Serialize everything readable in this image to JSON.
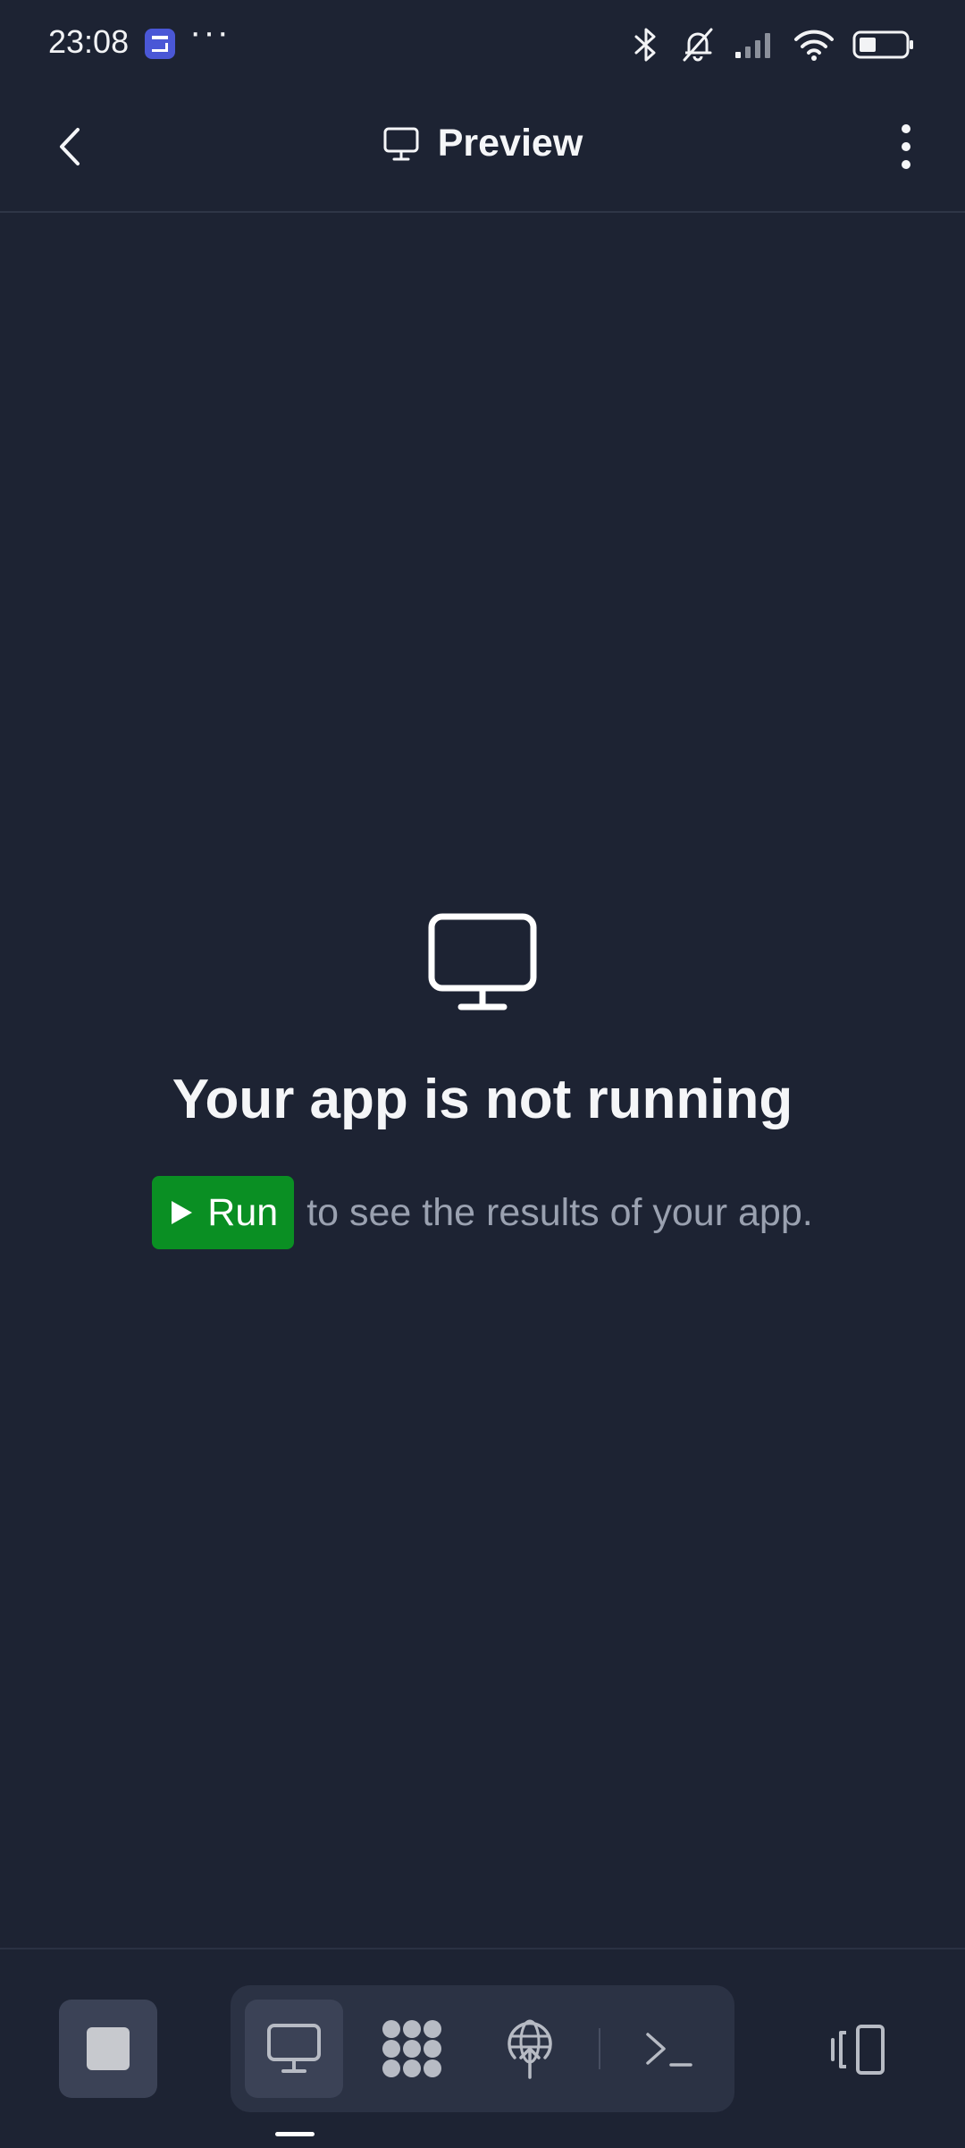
{
  "status_bar": {
    "time": "23:08",
    "overflow": "···",
    "icons": [
      "bluetooth-icon",
      "bell-off-icon",
      "signal-icon",
      "wifi-icon",
      "battery-icon"
    ]
  },
  "header": {
    "title": "Preview",
    "title_icon": "monitor-icon",
    "back_icon": "chevron-left-icon",
    "menu_icon": "more-vertical-icon"
  },
  "empty_state": {
    "icon": "monitor-icon",
    "title": "Your app is not running",
    "run_button": {
      "label": "Run",
      "icon": "play-icon"
    },
    "hint": "to see the results of your app."
  },
  "bottom_bar": {
    "stop_icon": "stop-icon",
    "tabs": [
      {
        "name": "preview",
        "icon": "monitor-icon",
        "active": true
      },
      {
        "name": "packages",
        "icon": "packages-icon",
        "active": false
      },
      {
        "name": "deploy",
        "icon": "globe-deploy-icon",
        "active": false
      },
      {
        "name": "console",
        "icon": "terminal-icon",
        "active": false
      }
    ],
    "device_icon": "device-switch-icon"
  },
  "colors": {
    "background": "#1d2333",
    "run_green": "#0a8f23",
    "muted_text": "#9aa1b0"
  }
}
